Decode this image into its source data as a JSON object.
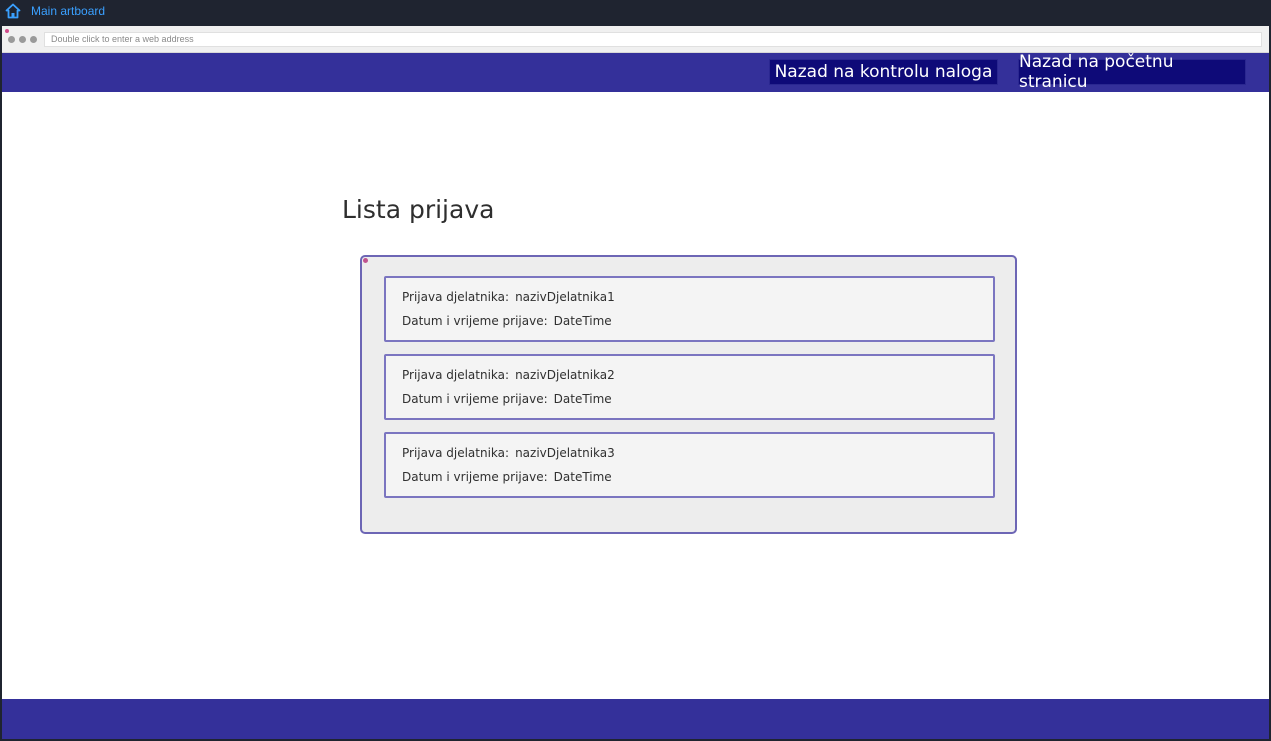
{
  "artboard": {
    "title": "Main artboard",
    "icon": "home-icon",
    "title_color": "#3aa0ff"
  },
  "browser": {
    "address_placeholder": "Double click to enter a web address"
  },
  "header": {
    "background": "#34309a",
    "buttons": [
      {
        "label": "Nazad na kontrolu naloga"
      },
      {
        "label": "Nazad na početnu stranicu"
      }
    ]
  },
  "main": {
    "title": "Lista prijava",
    "entries": [
      {
        "employee_label": "Prijava djelatnika:",
        "employee_value": "nazivDjelatnika1",
        "datetime_label": "Datum i vrijeme prijave:",
        "datetime_value": "DateTime"
      },
      {
        "employee_label": "Prijava djelatnika:",
        "employee_value": "nazivDjelatnika2",
        "datetime_label": "Datum i vrijeme prijave:",
        "datetime_value": "DateTime"
      },
      {
        "employee_label": "Prijava djelatnika:",
        "employee_value": "nazivDjelatnika3",
        "datetime_label": "Datum i vrijeme prijave:",
        "datetime_value": "DateTime"
      }
    ]
  }
}
